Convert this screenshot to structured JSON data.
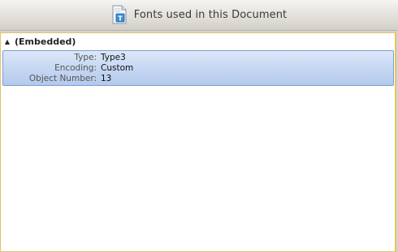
{
  "header": {
    "title": "Fonts used in this Document",
    "icon": "document-font-icon"
  },
  "fonts_panel": {
    "groups": [
      {
        "label": "(Embedded)",
        "expanded": true,
        "items": [
          {
            "selected": true,
            "properties": [
              {
                "label": "Type:",
                "value": "Type3"
              },
              {
                "label": "Encoding:",
                "value": "Custom"
              },
              {
                "label": "Object Number:",
                "value": "13"
              }
            ]
          }
        ]
      }
    ]
  },
  "colors": {
    "selection_border": "#7b9fd0",
    "selection_fill": "#c8d9f3",
    "panel_border": "#e3c46a"
  }
}
